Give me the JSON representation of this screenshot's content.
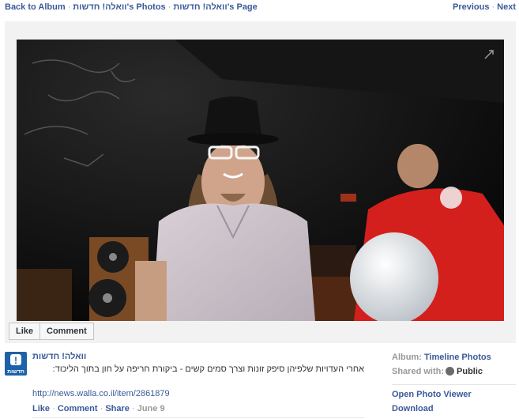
{
  "nav": {
    "back_label": "Back to Album",
    "photos_label": "וואלה! חדשות's Photos",
    "page_label": "וואלה! חדשות's Page",
    "separator": "·",
    "previous_label": "Previous",
    "next_label": "Next"
  },
  "photo": {
    "expand_icon": "expand-arrow-icon",
    "content_icons": [
      "man-with-hat-figure",
      "red-shirt-figure",
      "white-balloon",
      "vinyl-speaker"
    ]
  },
  "actions": {
    "like_label": "Like",
    "comment_label": "Comment"
  },
  "post": {
    "page_name": "וואלה! חדשות",
    "logo_icon": "walla-news-logo",
    "logo_mark": "!",
    "logo_text": "חדשות",
    "text": "אחרי העדויות שלפיהן סיפק זונות וצרך סמים קשים - ביקורת חריפה על חון בתוך הליכוד:",
    "link": "http://news.walla.co.il/item/2861879",
    "like_label": "Like",
    "comment_label": "Comment",
    "share_label": "Share",
    "date": "June 9",
    "separator": "·"
  },
  "side": {
    "album_label": "Album:",
    "album_value": "Timeline Photos",
    "shared_label": "Shared with:",
    "shared_value": "Public",
    "shared_icon": "globe-icon",
    "open_viewer_label": "Open Photo Viewer",
    "download_label": "Download"
  },
  "colors": {
    "link": "#3b5998",
    "muted": "#999999",
    "stage_bg": "#f2f2f2",
    "logo_bg": "#1d62a8"
  }
}
